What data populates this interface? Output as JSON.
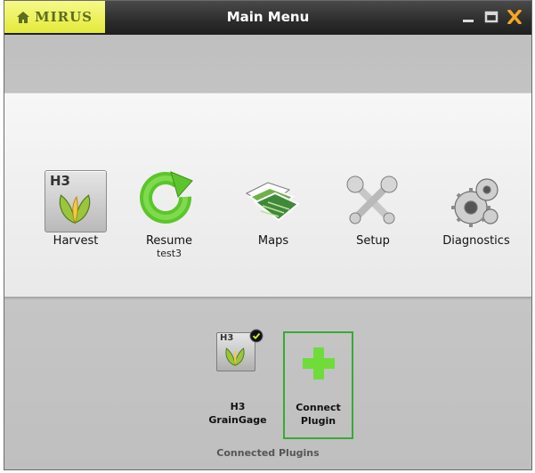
{
  "window": {
    "title": "Main Menu",
    "brand": "MIRUS",
    "controls": [
      "minimize-icon",
      "maximize-icon",
      "close-icon"
    ]
  },
  "menu": {
    "items": [
      {
        "label": "Harvest",
        "icon": "harvest-h3-icon"
      },
      {
        "label": "Resume",
        "sub": "test3",
        "icon": "resume-icon"
      },
      {
        "label": "Maps",
        "icon": "maps-icon"
      },
      {
        "label": "Setup",
        "icon": "setup-tools-icon"
      },
      {
        "label": "Diagnostics",
        "icon": "diagnostics-gears-icon"
      }
    ]
  },
  "plugins": {
    "connected": [
      {
        "label_line1": "H3",
        "label_line2": "GrainGage",
        "icon": "h3-graingage-icon",
        "status": "connected"
      }
    ],
    "connect": {
      "label_line1": "Connect",
      "label_line2": "Plugin",
      "icon": "plus-icon"
    },
    "caption": "Connected Plugins"
  },
  "colors": {
    "accent_green": "#39a935",
    "brand_yellow": "#e4ea3a",
    "close_orange": "#f5a623"
  }
}
